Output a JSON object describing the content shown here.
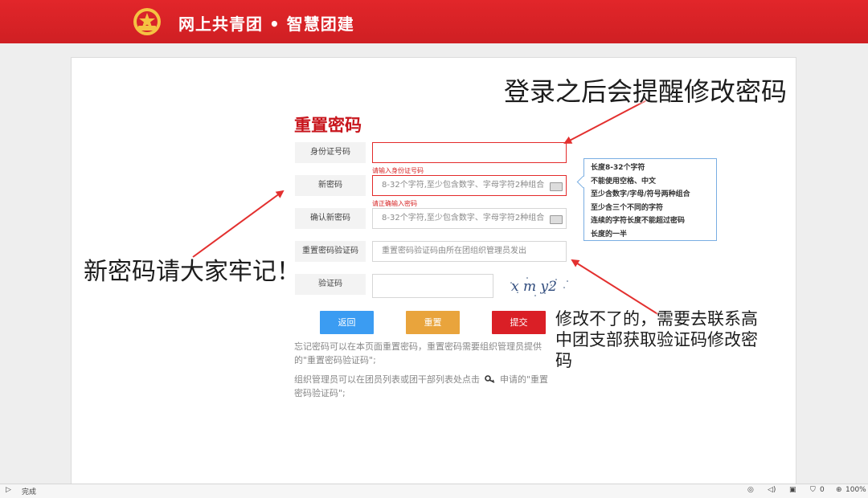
{
  "header": {
    "logo_icon": "youth-league-emblem-icon",
    "title": "网上共青团 • 智慧团建",
    "color": "#d9232a"
  },
  "form": {
    "title": "重置密码",
    "fields": [
      {
        "label": "身份证号码",
        "value": "",
        "placeholder": ""
      },
      {
        "label": "新密码",
        "value": "",
        "placeholder": "8-32个字符,至少包含数字、字母字符2种组合"
      },
      {
        "label": "确认新密码",
        "value": "",
        "placeholder": "8-32个字符,至少包含数字、字母字符2种组合"
      },
      {
        "label": "重置密码验证码",
        "value": "",
        "placeholder": "重置密码验证码由所在团组织管理员发出"
      },
      {
        "label": "验证码",
        "value": "",
        "placeholder": ""
      }
    ],
    "errors": {
      "id_number": "请输入身份证号码",
      "new_password": "请正确输入密码"
    },
    "captcha_text": "x m y2",
    "buttons": {
      "back": "返回",
      "reset": "重置",
      "submit": "提交"
    },
    "button_colors": {
      "back": "#3b9cf2",
      "reset": "#e9a43c",
      "submit": "#da1f26"
    },
    "notes": {
      "note1_line1": "忘记密码可以在本页面重置密码，重置密码需要组织管理员提供",
      "note1_line2": "的\"重置密码验证码\";",
      "note2_line1a": "组织管理员可以在团员列表或团干部列表处点击",
      "note2_line1b": "申请的\"重置",
      "note2_line2": "密码验证码\";"
    }
  },
  "password_tip": {
    "lines": [
      "长度8-32个字符",
      "不能使用空格、中文",
      "至少含数字/字母/符号两种组合",
      "至少含三个不同的字符",
      "连续的字符长度不能超过密码",
      "长度的一半"
    ]
  },
  "annotations": {
    "login_reminder": "登录之后会提醒修改密码",
    "remember_password": "新密码请大家牢记！",
    "contact_line1": "修改不了的，需要去联系高",
    "contact_line2": "中团支部获取验证码修改密",
    "contact_line3": "码"
  },
  "statusbar": {
    "status": "完成",
    "badge_count": "0",
    "zoom": "100%"
  }
}
